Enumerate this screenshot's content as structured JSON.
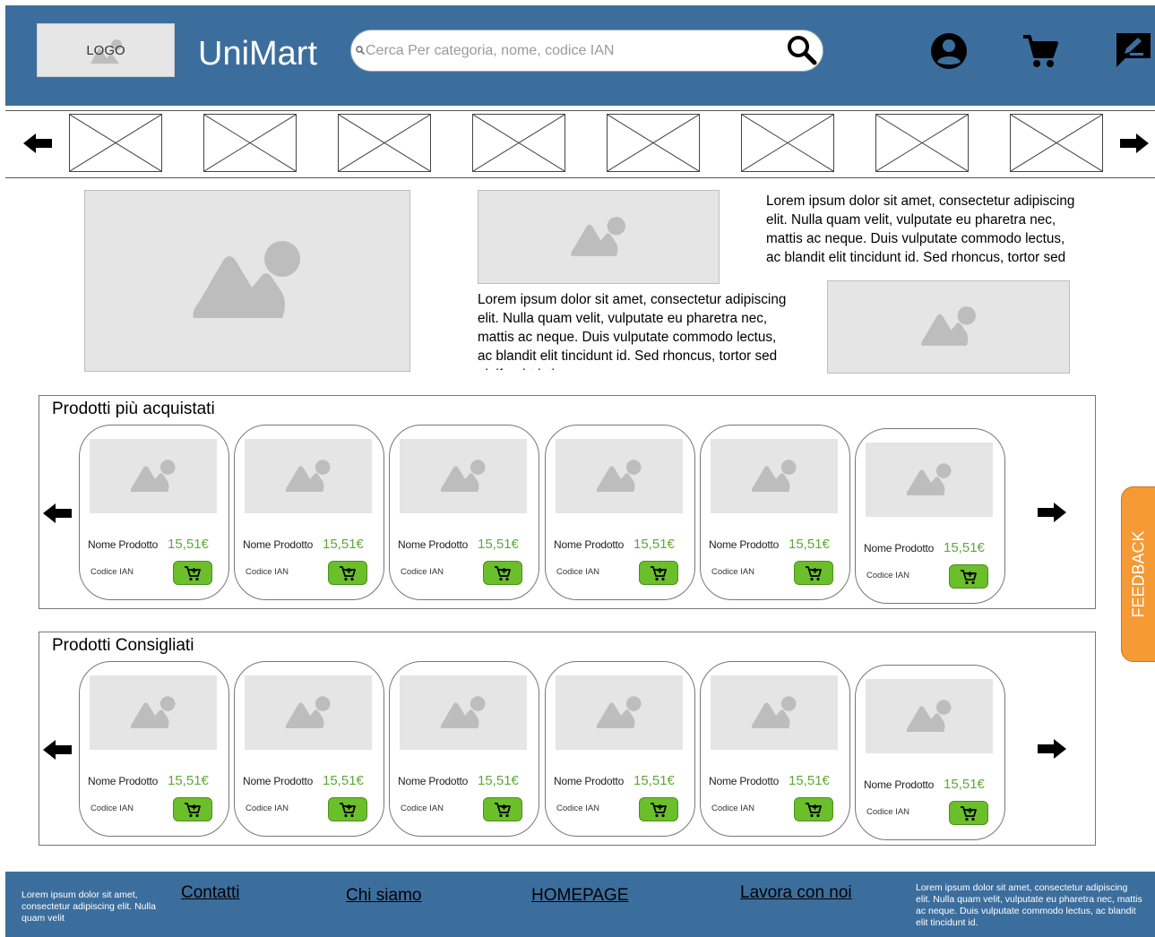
{
  "header": {
    "logo_text": "LOGO",
    "app_title": "UniMart",
    "search_placeholder": "Cerca Per categoria, nome, codice IAN"
  },
  "promo": {
    "text_block_1": "Lorem ipsum dolor sit amet, consectetur adipiscing elit. Nulla quam velit, vulputate eu pharetra nec, mattis ac neque. Duis vulputate commodo lectus, ac blandit elit tincidunt id. Sed rhoncus, tortor sed eleifend tristique",
    "text_block_2": "Lorem ipsum dolor sit amet, consectetur adipiscing elit. Nulla quam velit, vulputate eu pharetra nec, mattis ac neque. Duis vulputate commodo lectus, ac blandit elit tincidunt id. Sed rhoncus, tortor sed eleifend tristique"
  },
  "sections": [
    {
      "title": "Prodotti più acquistati",
      "products": [
        {
          "name": "Nome Prodotto",
          "price": "15,51€",
          "code": "Codice IAN"
        },
        {
          "name": "Nome Prodotto",
          "price": "15,51€",
          "code": "Codice IAN"
        },
        {
          "name": "Nome Prodotto",
          "price": "15,51€",
          "code": "Codice IAN"
        },
        {
          "name": "Nome Prodotto",
          "price": "15,51€",
          "code": "Codice IAN"
        },
        {
          "name": "Nome Prodotto",
          "price": "15,51€",
          "code": "Codice IAN"
        },
        {
          "name": "Nome Prodotto",
          "price": "15,51€",
          "code": "Codice IAN"
        }
      ]
    },
    {
      "title": "Prodotti Consigliati",
      "products": [
        {
          "name": "Nome Prodotto",
          "price": "15,51€",
          "code": "Codice IAN"
        },
        {
          "name": "Nome Prodotto",
          "price": "15,51€",
          "code": "Codice IAN"
        },
        {
          "name": "Nome Prodotto",
          "price": "15,51€",
          "code": "Codice IAN"
        },
        {
          "name": "Nome Prodotto",
          "price": "15,51€",
          "code": "Codice IAN"
        },
        {
          "name": "Nome Prodotto",
          "price": "15,51€",
          "code": "Codice IAN"
        },
        {
          "name": "Nome Prodotto",
          "price": "15,51€",
          "code": "Codice IAN"
        }
      ]
    }
  ],
  "feedback": {
    "label": "FEEDBACK"
  },
  "footer": {
    "left_text": "Lorem ipsum dolor sit amet, consectetur adipiscing elit. Nulla quam velit",
    "links": [
      "Contatti",
      "Chi siamo",
      "HOMEPAGE",
      "Lavora con noi"
    ],
    "right_text": "Lorem ipsum dolor sit amet, consectetur adipiscing elit. Nulla quam velit, vulputate eu pharetra nec, mattis ac neque. Duis vulputate commodo lectus, ac blandit elit tincidunt id."
  },
  "colors": {
    "header_bg": "#3c6e9d",
    "price_green": "#5fa83a",
    "cart_button": "#6bbf2a",
    "feedback_orange": "#f59a35"
  },
  "icons": {
    "header": [
      "search-icon",
      "user-account-icon",
      "shopping-cart-icon",
      "edit-note-icon"
    ],
    "carousel": [
      "arrow-left-icon",
      "arrow-right-icon"
    ],
    "product": [
      "image-placeholder-icon",
      "add-to-cart-icon"
    ]
  }
}
